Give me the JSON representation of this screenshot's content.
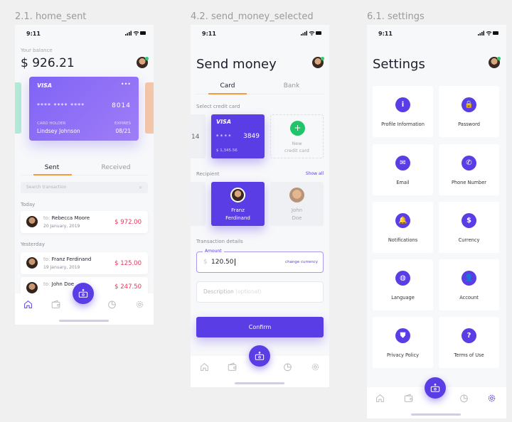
{
  "frames": [
    "2.1. home_sent",
    "4.2. send_money_selected",
    "6.1. settings"
  ],
  "colors": {
    "accent": "#5b3de6",
    "tab_underline": "#f59b3d",
    "negative": "#f0335e",
    "online": "#2ecc71",
    "add": "#22c46a"
  },
  "status_time": "9:11",
  "home": {
    "balance_label": "Your balance",
    "balance": "$ 926.21",
    "card": {
      "brand": "VISA",
      "menu": "•••",
      "mask": "****  ****  ****",
      "last4": "8014",
      "holder_label": "CARD HOLDER",
      "holder": "Lindsey Johnson",
      "expires_label": "EXPIRES",
      "expires": "08/21"
    },
    "tabs": [
      "Sent",
      "Received"
    ],
    "search_placeholder": "Search transaction",
    "groups": [
      {
        "label": "Today"
      },
      {
        "label": "Yesterday"
      }
    ],
    "transactions": [
      {
        "to": "to:",
        "name": "Rebecca Moore",
        "date": "20 January, 2019",
        "amount": "$ 972.00"
      },
      {
        "to": "to:",
        "name": "Franz Ferdinand",
        "date": "19 January, 2019",
        "amount": "$ 125.00"
      },
      {
        "to": "to:",
        "name": "John Doe",
        "date": "",
        "amount": "$ 247.50"
      }
    ]
  },
  "send": {
    "title": "Send money",
    "tabs": [
      "Card",
      "Bank"
    ],
    "select_card_label": "Select credit card",
    "prev_card_digits": "14",
    "card": {
      "brand": "VISA",
      "mask": "* * * *",
      "last4": "3849",
      "balance": "$ 1,345.56"
    },
    "new_card": {
      "icon": "+",
      "label1": "New",
      "label2": "credit card"
    },
    "recipient_label": "Recipient",
    "show_all": "Show all",
    "recipients": [
      {
        "first": "Franz",
        "last": "Ferdinand",
        "selected": true
      },
      {
        "first": "John",
        "last": "Doe",
        "selected": false
      }
    ],
    "details_label": "Transaction details",
    "amount_label": "Amount",
    "currency": "$",
    "amount": "120.50",
    "change_currency": "change currency",
    "description_placeholder": "Description",
    "description_optional": "(optional)",
    "confirm": "Confirm"
  },
  "settings": {
    "title": "Settings",
    "items": [
      {
        "label": "Profile Information",
        "icon": "info-icon",
        "glyph": "i"
      },
      {
        "label": "Password",
        "icon": "lock-icon",
        "glyph": "🔒"
      },
      {
        "label": "Email",
        "icon": "mail-icon",
        "glyph": "✉"
      },
      {
        "label": "Phone Number",
        "icon": "phone-icon",
        "glyph": "✆"
      },
      {
        "label": "Notifications",
        "icon": "bell-icon",
        "glyph": "🔔"
      },
      {
        "label": "Currency",
        "icon": "dollar-icon",
        "glyph": "$"
      },
      {
        "label": "Language",
        "icon": "globe-icon",
        "glyph": "◍"
      },
      {
        "label": "Account",
        "icon": "user-icon",
        "glyph": "👤"
      },
      {
        "label": "Privacy Policy",
        "icon": "shield-icon",
        "glyph": "⛊"
      },
      {
        "label": "Terms of Use",
        "icon": "question-icon",
        "glyph": "?"
      }
    ]
  },
  "nav": [
    "home-icon",
    "wallet-icon",
    "send-money-icon",
    "chart-icon",
    "settings-icon"
  ]
}
